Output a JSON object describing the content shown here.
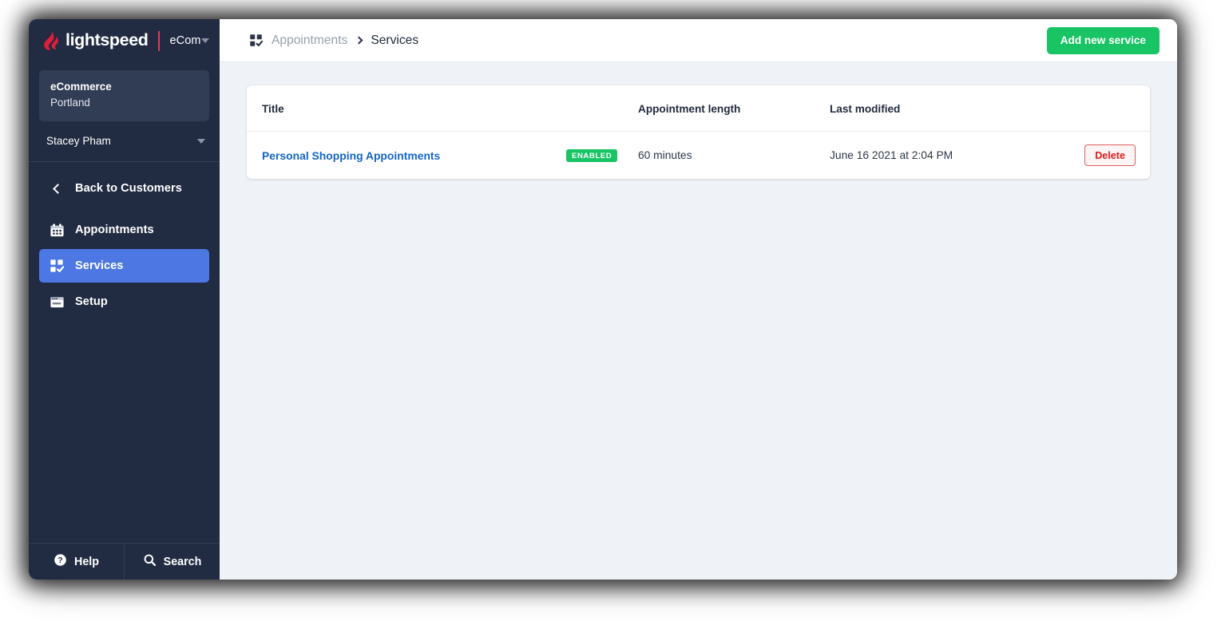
{
  "brand": {
    "logo_icon": "lightspeed-flame-icon",
    "wordmark": "lightspeed",
    "product": "eCom",
    "product_caret_icon": "chevron-down-icon"
  },
  "sidebar": {
    "shop": {
      "name": "eCommerce",
      "location": "Portland"
    },
    "user": {
      "name": "Stacey Pham",
      "caret_icon": "chevron-down-icon"
    },
    "back": {
      "label": "Back to Customers",
      "icon": "chevron-left-icon"
    },
    "items": [
      {
        "label": "Appointments",
        "icon": "calendar-icon",
        "active": false
      },
      {
        "label": "Services",
        "icon": "services-grid-check-icon",
        "active": true
      },
      {
        "label": "Setup",
        "icon": "window-setup-icon",
        "active": false
      }
    ],
    "footer": [
      {
        "label": "Help",
        "icon": "question-circle-icon"
      },
      {
        "label": "Search",
        "icon": "search-icon"
      }
    ]
  },
  "topbar": {
    "breadcrumb_icon": "services-grid-check-icon",
    "breadcrumb": [
      "Appointments",
      "Services"
    ],
    "separator_icon": "chevron-right-icon",
    "add_button": "Add new service"
  },
  "table": {
    "columns": [
      "Title",
      "Appointment length",
      "Last modified"
    ],
    "rows": [
      {
        "title": "Personal Shopping Appointments",
        "status": "ENABLED",
        "length": "60 minutes",
        "last_modified": "June 16 2021 at 2:04 PM",
        "action": "Delete"
      }
    ]
  },
  "colors": {
    "sidebar_bg": "#212b42",
    "active_nav": "#4d78e3",
    "accent_green": "#19c465",
    "brand_red": "#e8384f",
    "link_blue": "#1565c8",
    "delete_red": "#d92020",
    "content_bg": "#eff2f6"
  }
}
